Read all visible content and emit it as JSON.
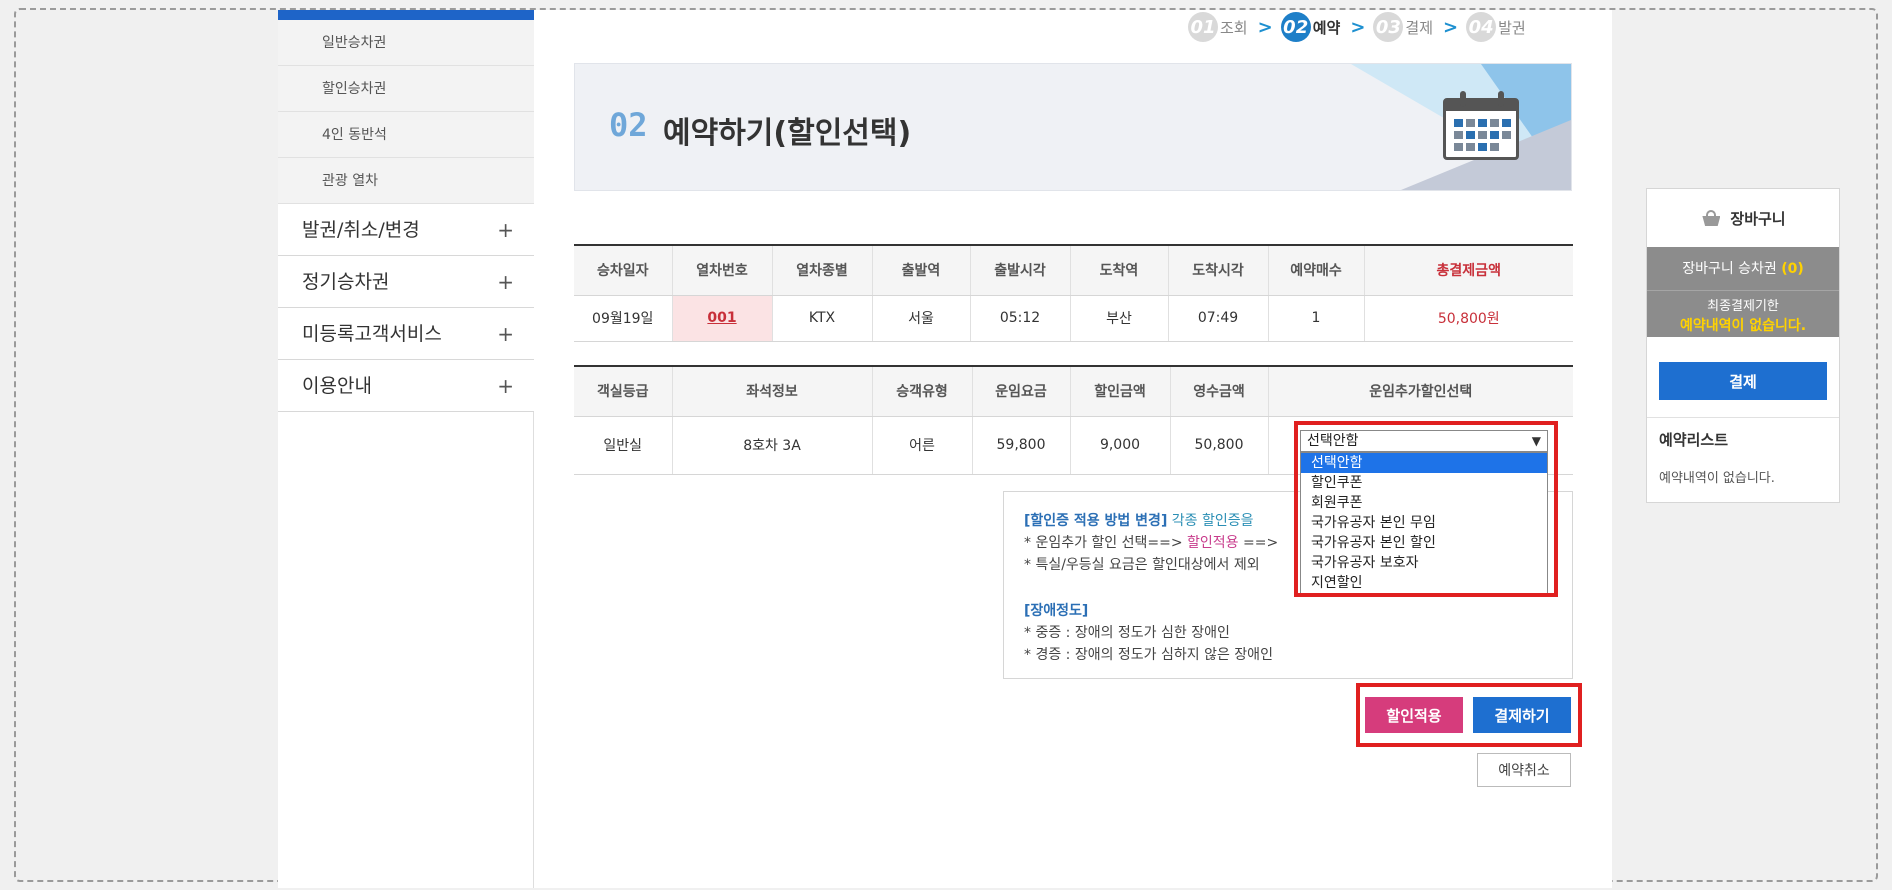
{
  "sidebar": {
    "sub_items": [
      {
        "label": "일반승차권"
      },
      {
        "label": "할인승차권"
      },
      {
        "label": "4인 동반석"
      },
      {
        "label": "관광 열차"
      }
    ],
    "menu_items": [
      {
        "label": "발권/취소/변경"
      },
      {
        "label": "정기승차권"
      },
      {
        "label": "미등록고객서비스"
      },
      {
        "label": "이용안내"
      }
    ],
    "plus_symbol": "+"
  },
  "steps": [
    {
      "num": "01",
      "label": "조회"
    },
    {
      "num": "02",
      "label": "예약"
    },
    {
      "num": "03",
      "label": "결제"
    },
    {
      "num": "04",
      "label": "발권"
    }
  ],
  "step_arrow": ">",
  "banner": {
    "num": "02",
    "title": "예약하기(할인선택)"
  },
  "train_table": {
    "headers": [
      "승차일자",
      "열차번호",
      "열차종별",
      "출발역",
      "출발시각",
      "도착역",
      "도착시각",
      "예약매수",
      "총결제금액"
    ],
    "row": {
      "date": "09월19일",
      "train_no": "001",
      "train_type": "KTX",
      "depart_station": "서울",
      "depart_time": "05:12",
      "arrive_station": "부산",
      "arrive_time": "07:49",
      "count": "1",
      "total": "50,800원"
    }
  },
  "seat_table": {
    "headers": [
      "객실등급",
      "좌석정보",
      "승객유형",
      "운임요금",
      "할인금액",
      "영수금액",
      "운임추가할인선택"
    ],
    "row": {
      "class": "일반실",
      "seat": "8호차 3A",
      "passenger": "어른",
      "fare": "59,800",
      "discount": "9,000",
      "paid": "50,800"
    }
  },
  "discount_select": {
    "selected": "선택안함",
    "options": [
      "선택안함",
      "할인쿠폰",
      "회원쿠폰",
      "국가유공자 본인 무임",
      "국가유공자 본인 할인",
      "국가유공자 보호자",
      "지연할인"
    ]
  },
  "info": {
    "title": "[할인증 적용 방법 변경]",
    "title_rest": "각종 할인증을",
    "line1_pre": "* 운임추가 할인 선택==>",
    "line1_pink": "할인적용",
    "line1_post": "==>",
    "line2": "* 특실/우등실 요금은 할인대상에서 제외",
    "section": "[장애정도]",
    "line3": "* 중증 : 장애의 정도가 심한 장애인",
    "line4": "* 경증 : 장애의 정도가 심하지 않은 장애인"
  },
  "buttons": {
    "apply": "할인적용",
    "pay": "결제하기",
    "cancel": "예약취소"
  },
  "cart": {
    "title": "장바구니",
    "count_label": "장바구니 승차권",
    "count_value": "(0)",
    "deadline_label": "최종결제기한",
    "deadline_value": "예약내역이 없습니다.",
    "pay": "결제",
    "list_title": "예약리스트",
    "list_empty": "예약내역이 없습니다."
  },
  "colors": {
    "accent_blue": "#1e6fd0",
    "pink": "#d63c7c",
    "highlight_red": "#e02020",
    "total_red": "#c8303a"
  }
}
